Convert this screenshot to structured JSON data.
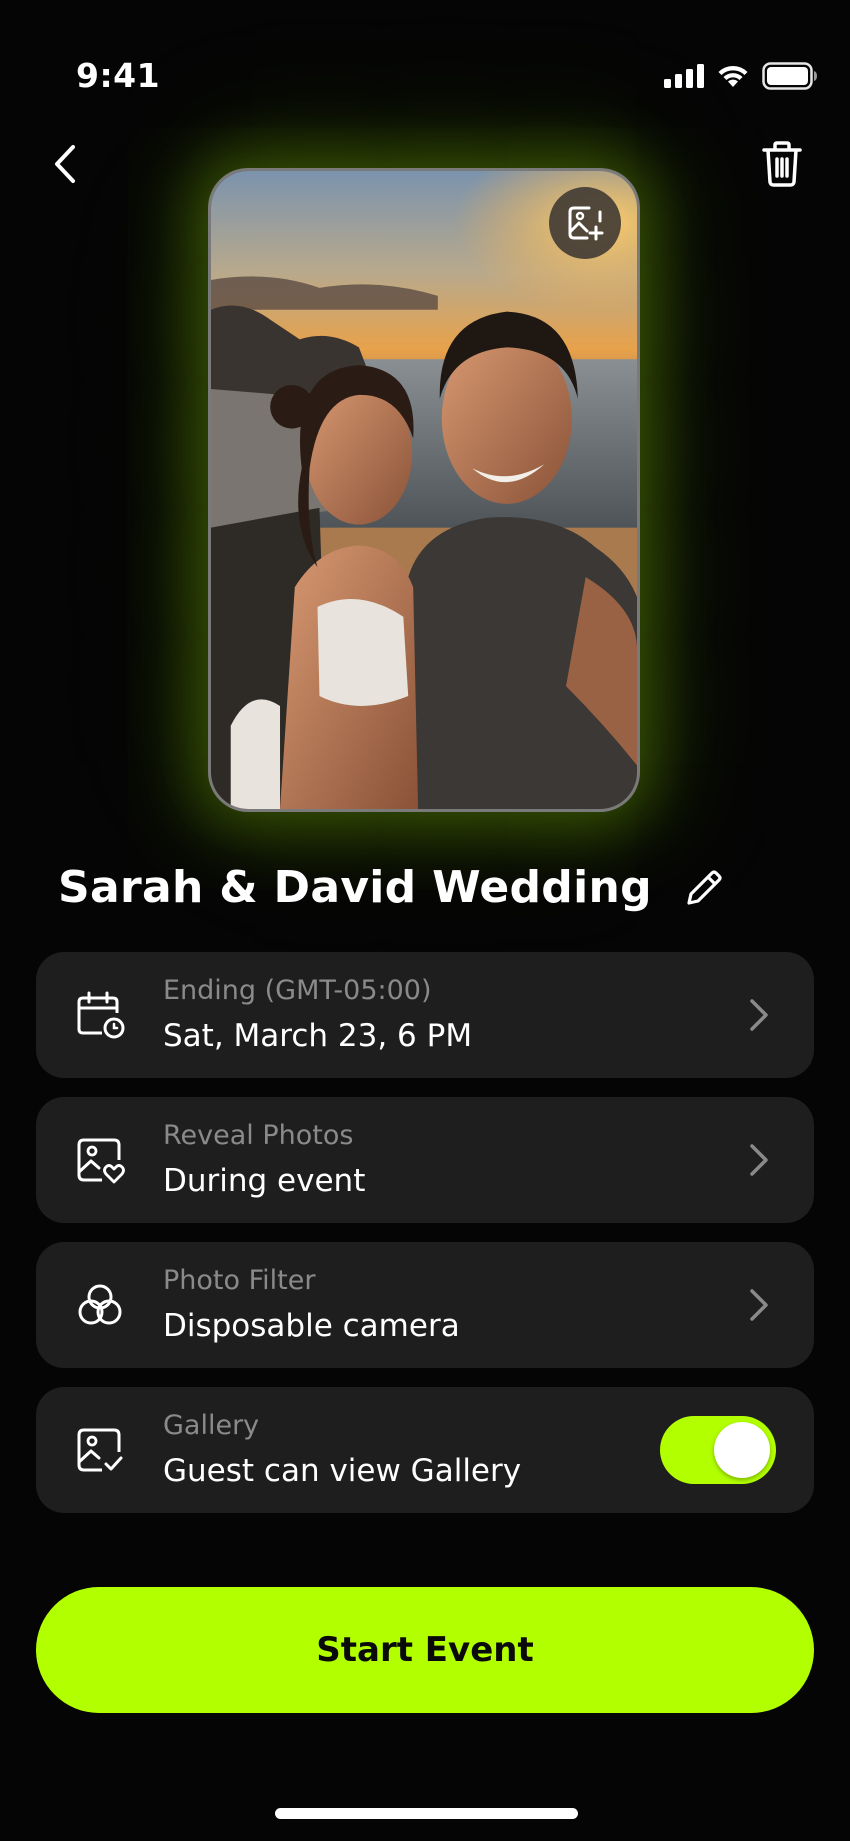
{
  "status_bar": {
    "time": "9:41"
  },
  "event": {
    "title": "Sarah & David Wedding"
  },
  "settings": [
    {
      "label": "Ending (GMT-05:00)",
      "value": "Sat, March 23, 6 PM",
      "icon": "calendar-clock-icon"
    },
    {
      "label": "Reveal Photos",
      "value": "During event",
      "icon": "image-heart-icon"
    },
    {
      "label": "Photo Filter",
      "value": "Disposable camera",
      "icon": "filter-circles-icon"
    },
    {
      "label": "Gallery",
      "value": "Guest can view Gallery",
      "icon": "image-check-icon",
      "toggle_on": true
    }
  ],
  "actions": {
    "start_label": "Start Event"
  },
  "colors": {
    "accent": "#b2ff00",
    "background": "#050505",
    "card": "#1e1e1e",
    "label": "#8a8a8a"
  }
}
